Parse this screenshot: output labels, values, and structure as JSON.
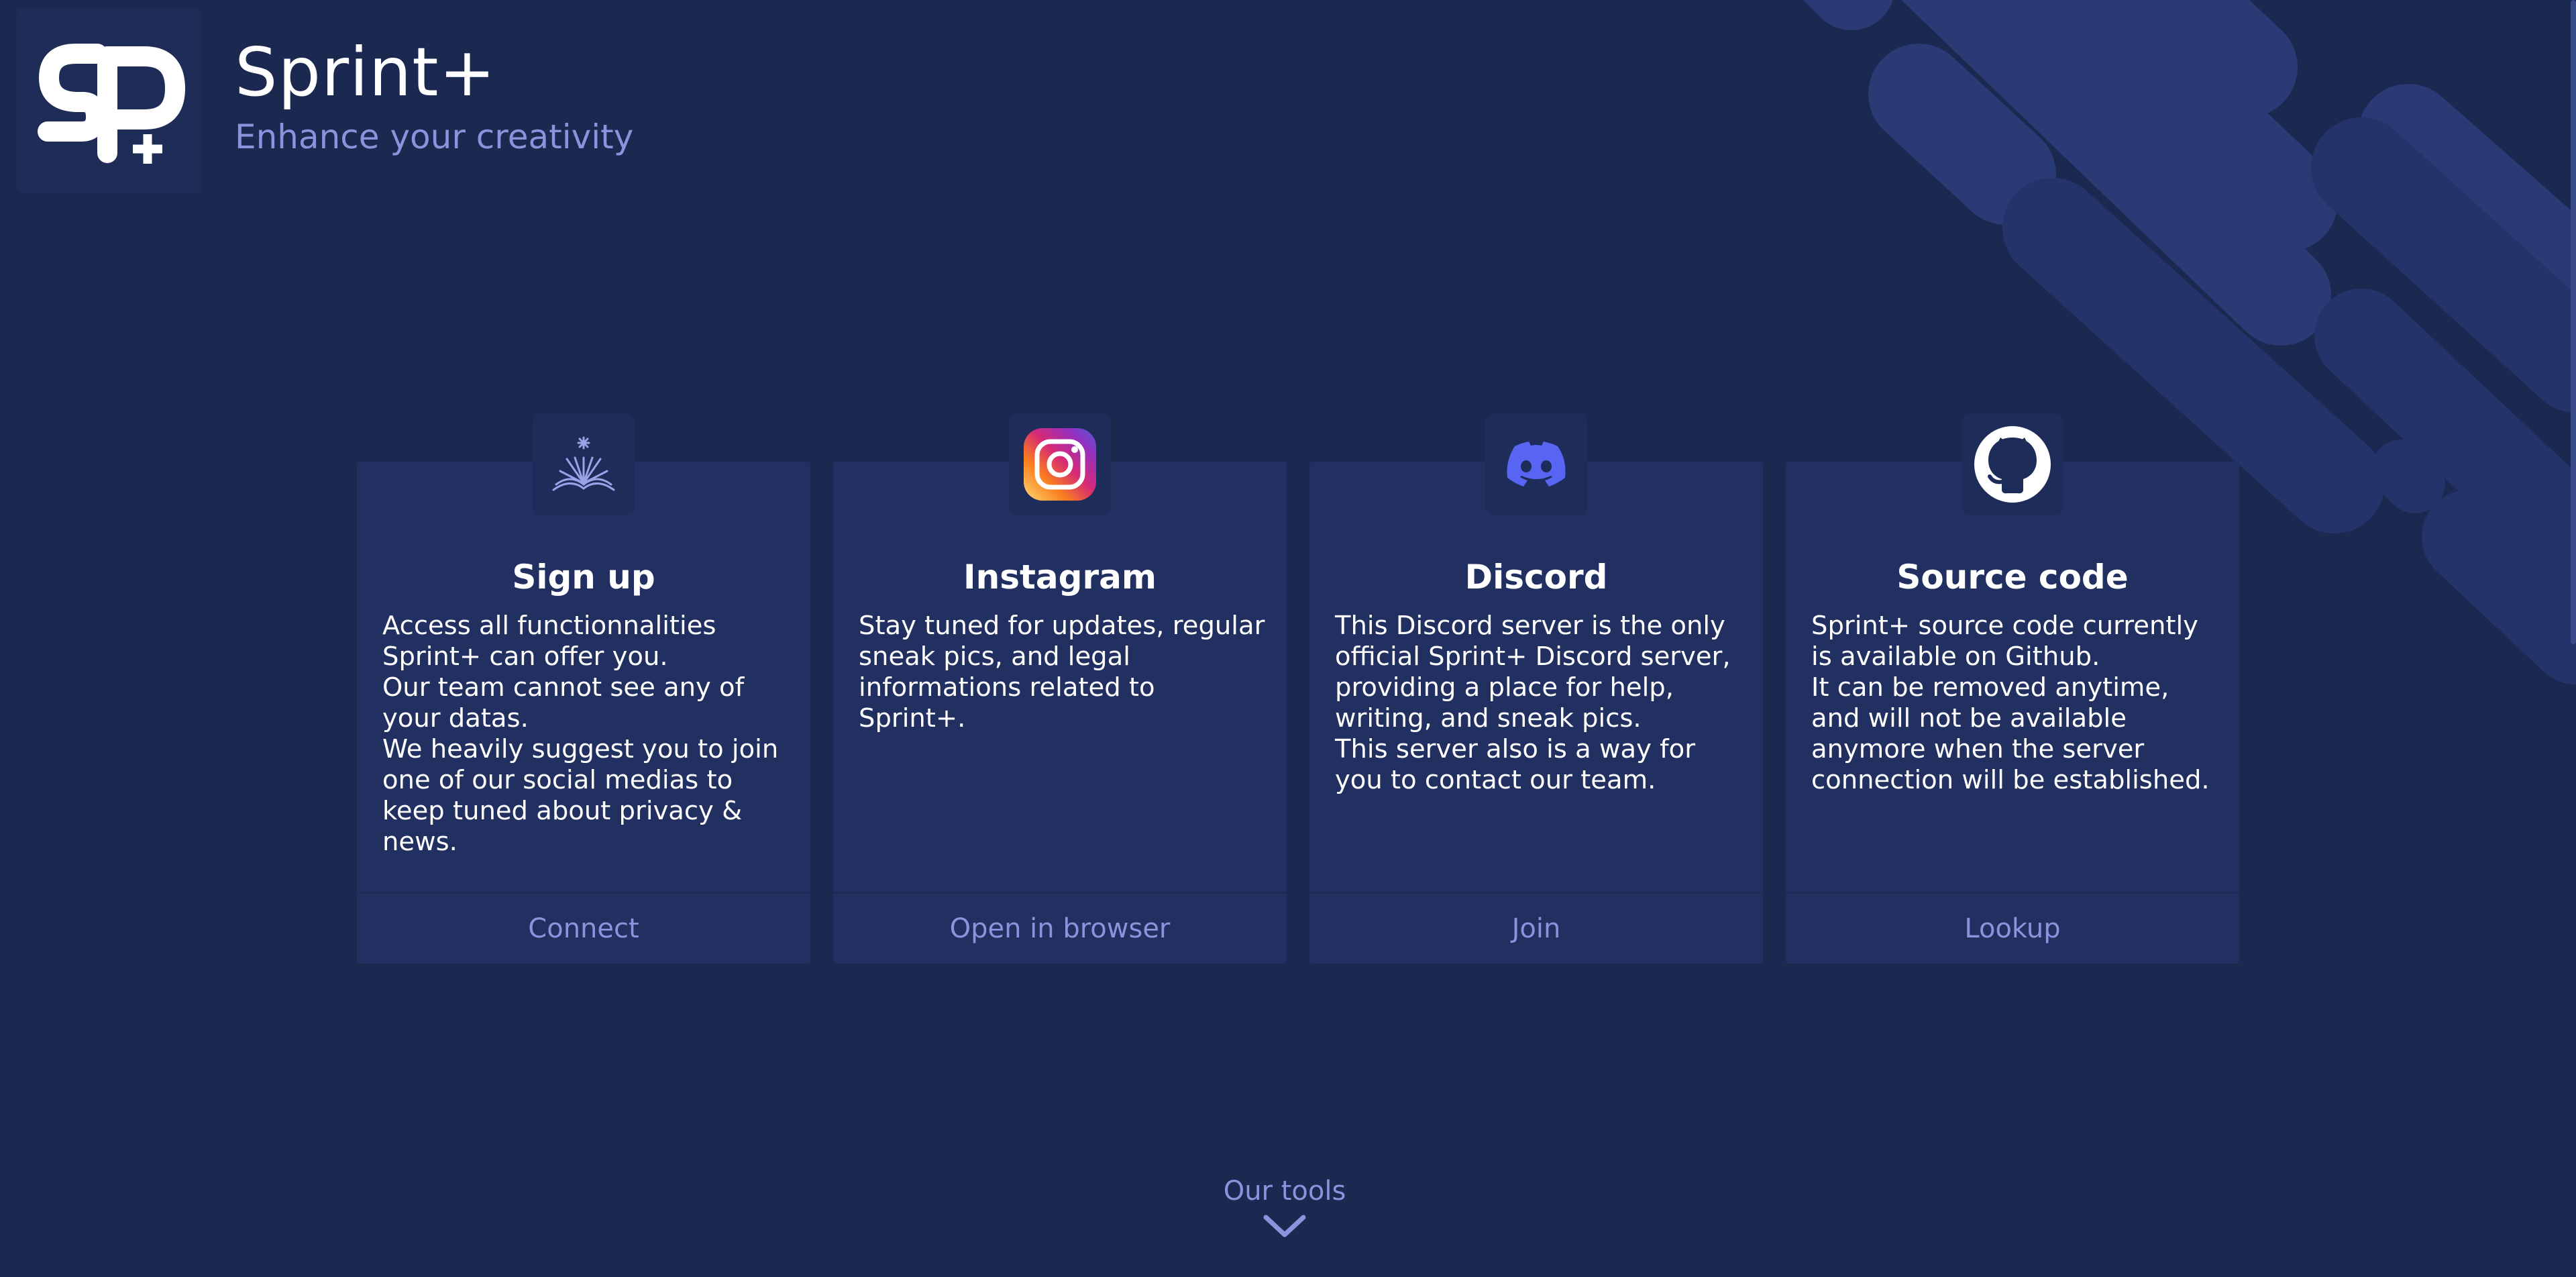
{
  "header": {
    "title": "Sprint+",
    "subtitle": "Enhance your creativity",
    "logo_icon": "sprint-plus-logo-icon"
  },
  "colors": {
    "background": "#1b2850",
    "card": "#213061",
    "accent": "#8b93dc",
    "stripes": "#2a3a75"
  },
  "cards": [
    {
      "icon": "bookspark-icon",
      "title": "Sign up",
      "body": "Access all functionnalities Sprint+ can offer you.\nOur team cannot see any of your datas.\nWe heavily suggest you to join one of our social medias to keep tuned about privacy & news.",
      "action": "Connect"
    },
    {
      "icon": "instagram-icon",
      "title": "Instagram",
      "body": "Stay tuned for updates, regular sneak pics, and legal informations related to Sprint+.",
      "action": "Open in browser"
    },
    {
      "icon": "discord-icon",
      "title": "Discord",
      "body": "This Discord server is the only official Sprint+ Discord server, providing a place for help, writing, and sneak pics.\nThis server also is a way for you to contact our team.",
      "action": "Join"
    },
    {
      "icon": "github-icon",
      "title": "Source code",
      "body": "Sprint+ source code currently is available on Github.\nIt can be removed anytime, and will not be available anymore when the server connection will be established.",
      "action": "Lookup"
    }
  ],
  "footer": {
    "tools_label": "Our tools",
    "chevron_icon": "chevron-down-icon"
  }
}
